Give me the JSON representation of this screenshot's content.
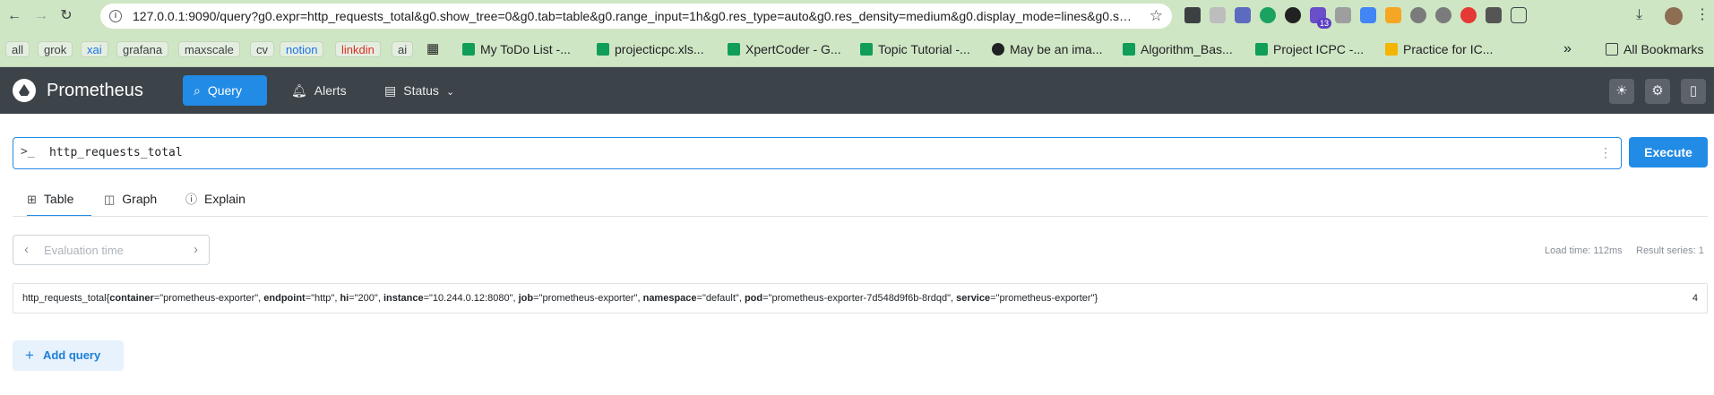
{
  "browser": {
    "url": "127.0.0.1:9090/query?g0.expr=http_requests_total&g0.show_tree=0&g0.tab=table&g0.range_input=1h&g0.res_type=auto&g0.res_density=medium&g0.display_mode=lines&g0.show_e...",
    "extension_badge": "13",
    "bookmark_tags": [
      "all",
      "grok",
      "xai",
      "grafana",
      "maxscale",
      "cv",
      "notion",
      "linkdin",
      "ai"
    ],
    "bookmarks": [
      "My ToDo List -...",
      "projecticpc.xls...",
      "XpertCoder - G...",
      "Topic Tutorial -...",
      "May be an ima...",
      "Algorithm_Bas...",
      "Project ICPC -...",
      "Practice for IC..."
    ],
    "more_label": "»",
    "all_bookmarks_label": "All Bookmarks"
  },
  "app": {
    "title": "Prometheus",
    "nav": {
      "query": "Query",
      "alerts": "Alerts",
      "status": "Status"
    }
  },
  "query": {
    "prompt": ">_",
    "expression": "http_requests_total",
    "execute_label": "Execute"
  },
  "tabs": {
    "table": "Table",
    "graph": "Graph",
    "explain": "Explain",
    "active": "Table"
  },
  "eval": {
    "placeholder": "Evaluation time"
  },
  "stats": {
    "load_time": "Load time: 112ms",
    "result_series": "Result series: 1"
  },
  "result": {
    "metric": "http_requests_total",
    "open": "{",
    "close": "}",
    "labels": [
      {
        "key": "container",
        "value": "\"prometheus-exporter\""
      },
      {
        "key": "endpoint",
        "value": "\"http\""
      },
      {
        "key": "hi",
        "value": "\"200\""
      },
      {
        "key": "instance",
        "value": "\"10.244.0.12:8080\""
      },
      {
        "key": "job",
        "value": "\"prometheus-exporter\""
      },
      {
        "key": "namespace",
        "value": "\"default\""
      },
      {
        "key": "pod",
        "value": "\"prometheus-exporter-7d548d9f6b-8rdqd\""
      },
      {
        "key": "service",
        "value": "\"prometheus-exporter\""
      }
    ],
    "value": "4"
  },
  "add_query_label": "Add query",
  "colors": {
    "accent": "#228be6",
    "navbar": "#3c4349",
    "chrome": "#cfe6c4"
  }
}
